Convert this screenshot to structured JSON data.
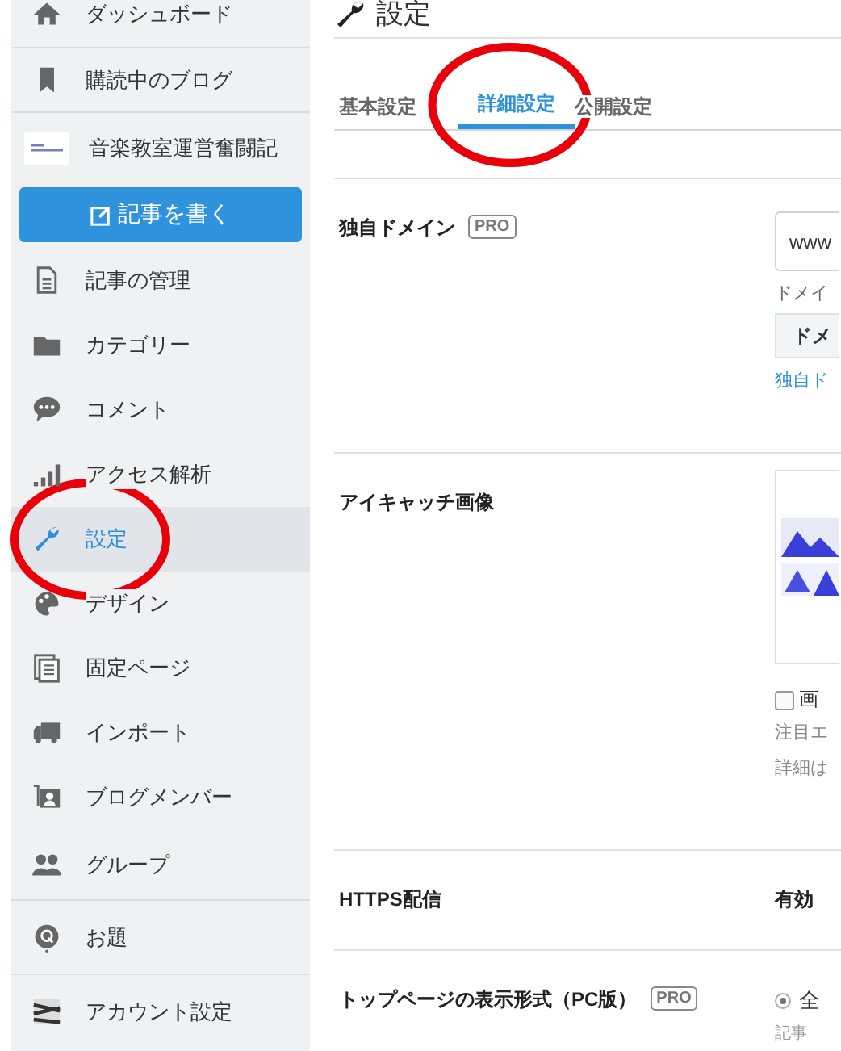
{
  "sidebar": {
    "top_items": [
      {
        "label": "ダッシュボード"
      },
      {
        "label": "購読中のブログ"
      }
    ],
    "blog": {
      "name": "音楽教室運営奮闘記",
      "write_button": "記事を書く"
    },
    "blog_items": [
      {
        "label": "記事の管理",
        "selected": false,
        "circled": false
      },
      {
        "label": "カテゴリー",
        "selected": false,
        "circled": false
      },
      {
        "label": "コメント",
        "selected": false,
        "circled": false
      },
      {
        "label": "アクセス解析",
        "selected": false,
        "circled": false
      },
      {
        "label": "設定",
        "selected": true,
        "circled": true
      },
      {
        "label": "デザイン",
        "selected": false,
        "circled": false
      },
      {
        "label": "固定ページ",
        "selected": false,
        "circled": false
      },
      {
        "label": "インポート",
        "selected": false,
        "circled": false
      },
      {
        "label": "ブログメンバー",
        "selected": false,
        "circled": false
      }
    ],
    "bottom_items": [
      {
        "label": "グループ"
      },
      {
        "label": "お題"
      },
      {
        "label": "アカウント設定"
      }
    ]
  },
  "page_title": "設定",
  "tabs": [
    {
      "label": "基本設定",
      "selected": false,
      "circled": false
    },
    {
      "label": "詳細設定",
      "selected": true,
      "circled": true
    },
    {
      "label": "公開設定",
      "selected": false,
      "circled": false
    }
  ],
  "settings": [
    {
      "kind": "domain",
      "label": "独自ドメイン",
      "badge": "PRO",
      "value": "www",
      "hint": "ドメイ",
      "button": "ドメ",
      "link": "独自ド"
    },
    {
      "label": "アイキャッチ画像",
      "checkbox": {
        "label": "画",
        "checked": false
      },
      "notes": [
        "注目エ",
        "詳細は"
      ]
    },
    {
      "kind": "text",
      "label": "HTTPS配信",
      "value": "有効"
    },
    {
      "kind": "radio",
      "label": "トップページの表示形式（PC版）",
      "badge": "PRO",
      "option": {
        "label": "全",
        "selected": true
      },
      "note": "記事"
    }
  ]
}
